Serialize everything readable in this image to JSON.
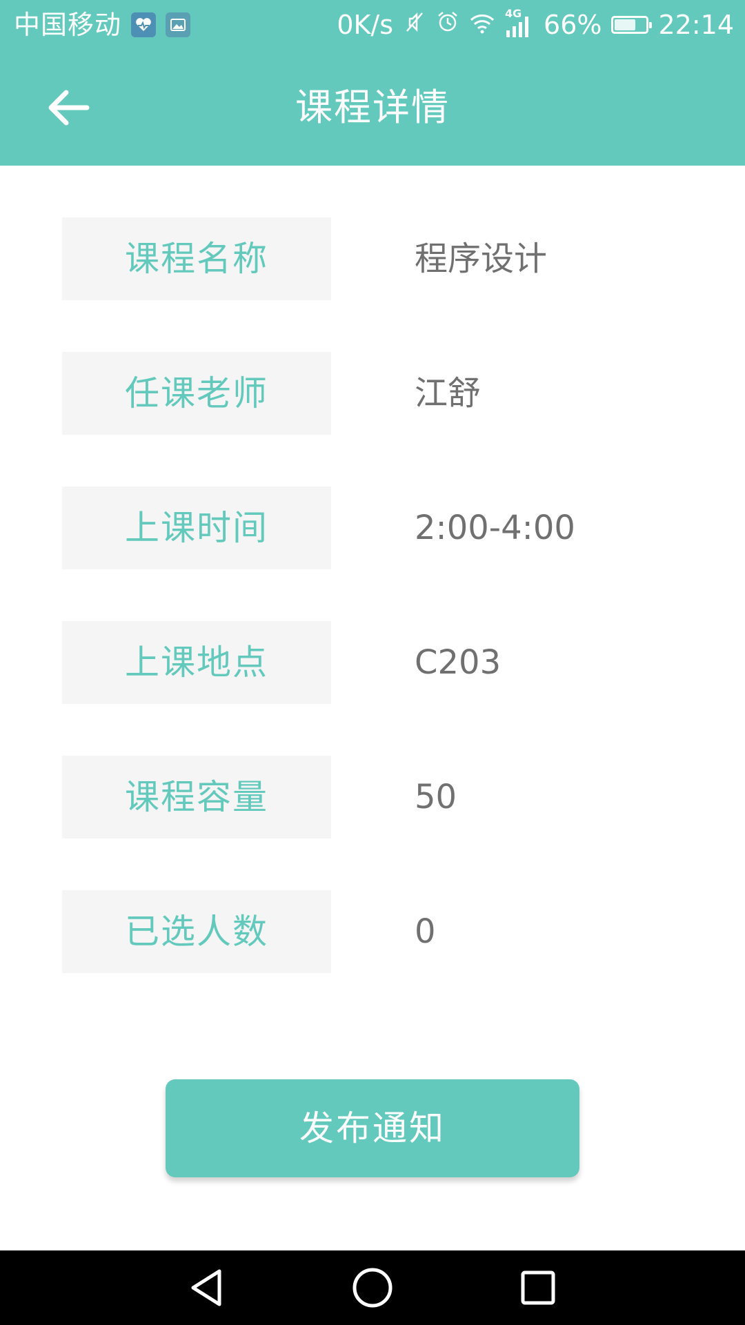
{
  "status_bar": {
    "carrier": "中国移动",
    "net_speed": "0K/s",
    "network_type": "4G",
    "battery": "66%",
    "battery_level": 0.66,
    "time": "22:14"
  },
  "app_bar": {
    "title": "课程详情",
    "back_icon": "arrow-left-icon"
  },
  "course": {
    "rows": [
      {
        "label": "课程名称",
        "value": "程序设计"
      },
      {
        "label": "任课老师",
        "value": "江舒"
      },
      {
        "label": "上课时间",
        "value": "2:00-4:00"
      },
      {
        "label": "上课地点",
        "value": "C203"
      },
      {
        "label": "课程容量",
        "value": "50"
      },
      {
        "label": "已选人数",
        "value": "0"
      }
    ]
  },
  "actions": {
    "publish_label": "发布通知"
  },
  "nav_bar": {
    "icons": [
      "back-triangle-icon",
      "home-circle-icon",
      "recents-square-icon"
    ]
  },
  "colors": {
    "accent": "#62c9bc",
    "label_bg": "#f5f5f5",
    "value_text": "#707070"
  }
}
